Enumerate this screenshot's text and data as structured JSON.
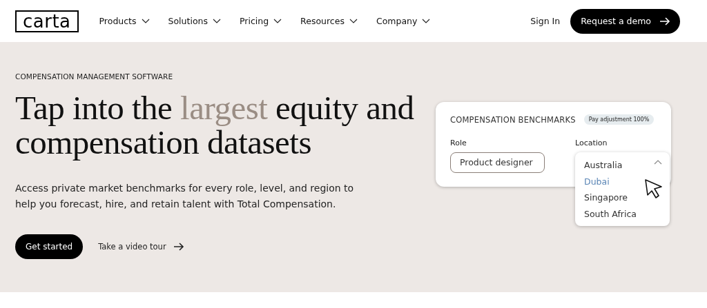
{
  "header": {
    "logo": "carta",
    "nav": [
      {
        "label": "Products"
      },
      {
        "label": "Solutions"
      },
      {
        "label": "Pricing"
      },
      {
        "label": "Resources"
      },
      {
        "label": "Company"
      }
    ],
    "sign_in": "Sign In",
    "cta": "Request a demo"
  },
  "hero": {
    "eyebrow": "COMPENSATION MANAGEMENT SOFTWARE",
    "heading": {
      "before": "Tap into the ",
      "highlight": "largest",
      "after": " equity and compensation datasets"
    },
    "description": "Access private market benchmarks for every role, level, and region to help you forecast, hire, and retain talent with Total Compensation.",
    "primary_button": "Get started",
    "secondary_link": "Take a video tour"
  },
  "benchmarks_card": {
    "title": "COMPENSATION BENCHMARKS",
    "badge": "Pay adjustment 100%",
    "role": {
      "label": "Role",
      "value": "Product designer"
    },
    "location": {
      "label": "Location",
      "expanded": true,
      "options": [
        {
          "label": "Australia",
          "selected": false
        },
        {
          "label": "Dubai",
          "selected": true
        },
        {
          "label": "Singapore",
          "selected": false
        },
        {
          "label": "South Africa",
          "selected": false
        }
      ]
    }
  }
}
